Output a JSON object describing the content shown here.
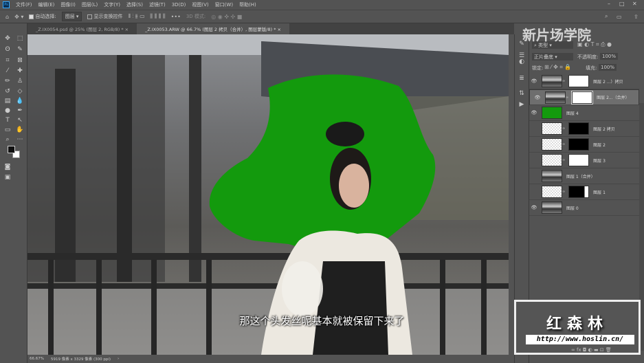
{
  "menu": [
    "文件(F)",
    "编辑(E)",
    "图像(I)",
    "图层(L)",
    "文字(Y)",
    "选择(S)",
    "滤镜(T)",
    "3D(D)",
    "视图(V)",
    "窗口(W)",
    "帮助(H)"
  ],
  "options": {
    "auto_select_label": "自动选择:",
    "auto_select_value": "图层",
    "show_transform_label": "显示变换控件",
    "mode_3d": "3D 模式:"
  },
  "tabs": [
    {
      "label": "_Z.IX0054.psd @ 25% (图层 2, RGB/8) *"
    },
    {
      "label": "_Z.IX0053.ARW @ 66.7% (图层 2 拷贝（合并）, 图层蒙版/8) *"
    }
  ],
  "status": {
    "zoom": "66.67%",
    "doc_info": "5919 像素 x 3329 像素 (300 ppi)"
  },
  "layers_panel": {
    "filter_type": "类型",
    "blend_mode": "正片叠底",
    "opacity_label": "不透明度:",
    "opacity": "100%",
    "lock_label": "锁定:",
    "fill_label": "填充:",
    "fill": "100%",
    "layers": [
      {
        "name": "图层 2 ...）拷贝",
        "visible": true
      },
      {
        "name": "图层 2...（合并）",
        "visible": true,
        "selected": true
      },
      {
        "name": "图层 4",
        "visible": true
      },
      {
        "name": "图层 2 拷贝",
        "visible": false
      },
      {
        "name": "图层 2",
        "visible": false
      },
      {
        "name": "图层 3",
        "visible": false
      },
      {
        "name": "图层 1（合并）",
        "visible": false
      },
      {
        "name": "图层 1",
        "visible": false
      },
      {
        "name": "图层 0",
        "visible": true
      }
    ]
  },
  "watermark": "新片场学院",
  "brand": {
    "name": "红森林",
    "url": "http://www.hoslin.cn/"
  },
  "subtitle": "那这个头发丝呢基本就被保留下来了",
  "colors": {
    "green_fill": "#139a0d",
    "panel": "#535353"
  }
}
